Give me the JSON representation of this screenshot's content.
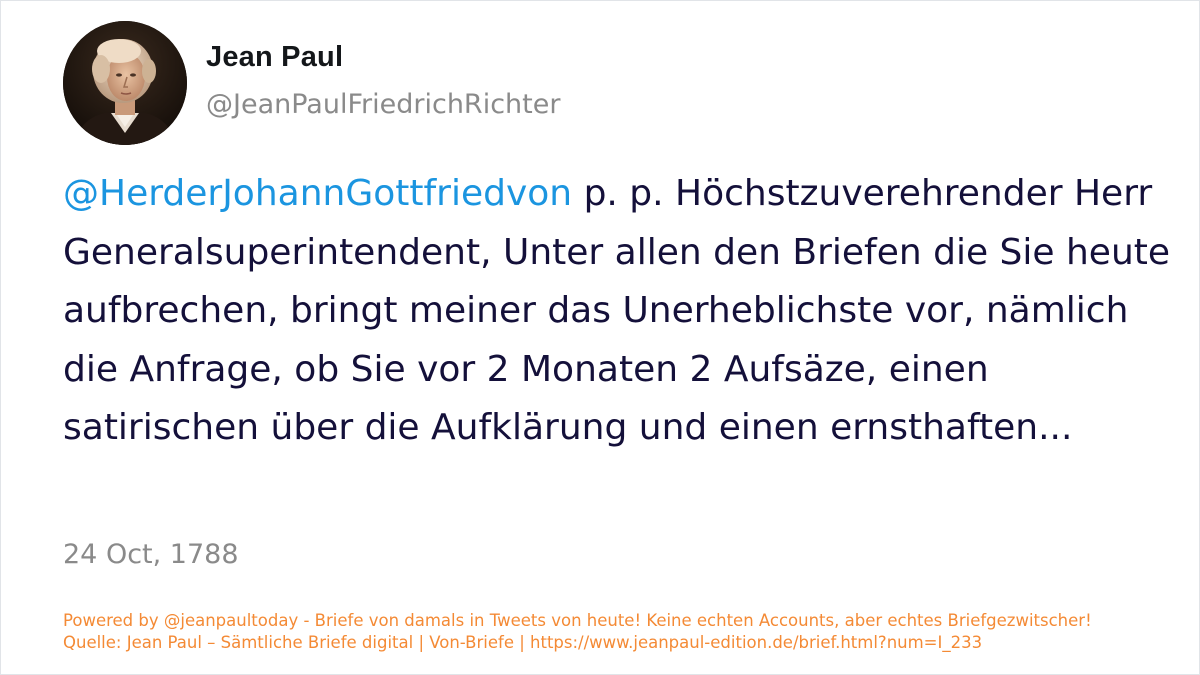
{
  "author": {
    "display_name": "Jean Paul",
    "handle": "@JeanPaulFriedrichRichter",
    "avatar_icon": "portrait-avatar"
  },
  "tweet": {
    "mention": "@HerderJohannGottfriedvon",
    "text": " p. p. Höchstzuverehrender Herr Generalsuperintendent, Unter allen den Briefen die Sie heute aufbrechen, bringt meiner das Unerheblichste vor, nämlich die Anfrage, ob Sie vor 2 Monaten 2 Aufsäze, einen satirischen über die Aufklärung und einen ernsthaften...",
    "date": "24 Oct, 1788"
  },
  "footer": {
    "line1": "Powered by @jeanpaultoday - Briefe von damals in Tweets von heute! Keine echten Accounts, aber echtes Briefgezwitscher!",
    "line2": "Quelle: Jean Paul – Sämtliche Briefe digital | Von-Briefe | https://www.jeanpaul-edition.de/brief.html?num=I_233"
  },
  "colors": {
    "mention": "#1b95e0",
    "text": "#14103a",
    "muted": "#8a8a8a",
    "footer": "#f48a35"
  }
}
